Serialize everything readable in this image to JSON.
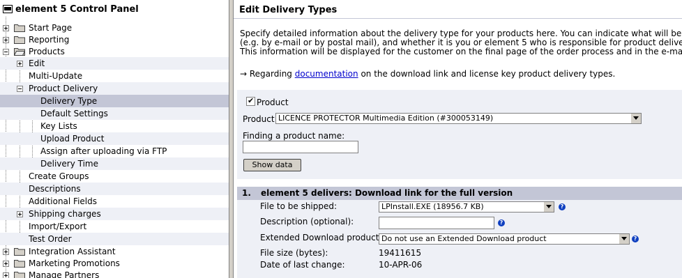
{
  "left_panel": {
    "title": "element 5 Control Panel",
    "items": [
      {
        "label": "Start Page"
      },
      {
        "label": "Reporting"
      },
      {
        "label": "Products"
      },
      {
        "label": "Edit"
      },
      {
        "label": "Multi-Update"
      },
      {
        "label": "Product Delivery"
      },
      {
        "label": "Delivery Type"
      },
      {
        "label": "Default Settings"
      },
      {
        "label": "Key Lists"
      },
      {
        "label": "Upload Product"
      },
      {
        "label": "Assign after uploading via FTP"
      },
      {
        "label": "Delivery Time"
      },
      {
        "label": "Create Groups"
      },
      {
        "label": "Descriptions"
      },
      {
        "label": "Additional Fields"
      },
      {
        "label": "Shipping charges"
      },
      {
        "label": "Import/Export"
      },
      {
        "label": "Test Order"
      },
      {
        "label": "Integration Assistant"
      },
      {
        "label": "Marketing Promotions"
      },
      {
        "label": "Manage Partners"
      }
    ]
  },
  "main": {
    "title": "Edit Delivery Types",
    "intro_line1": "Specify detailed information about the delivery type for your products here. You can indicate what will be deliv",
    "intro_line2": "(e.g. by e-mail or by postal mail), and whether it is you or element 5 who is responsible for product delivery.",
    "intro_line3": "This information will be displayed for the customer on the final page of the order process and in the e-mail wit",
    "regarding_prefix": "→ Regarding ",
    "regarding_link": "documentation",
    "regarding_suffix": " on the download link and license key product delivery types.",
    "product_checkbox_label": "Product",
    "product_label": "Product",
    "product_selected": "LICENCE PROTECTOR Multimedia Edition (#300053149)",
    "finding_label": "Finding a product name:",
    "finding_value": "",
    "show_data_button": "Show data",
    "section_number": "1.",
    "section_title": "element 5 delivers: Download link for the full version",
    "file_label": "File to be shipped:",
    "file_selected": "LPInstall.EXE (18956.7 KB)",
    "description_label": "Description (optional):",
    "description_value": "",
    "extended_label": "Extended Download product:",
    "extended_selected": "Do not use an Extended Download product",
    "filesize_label": "File size (bytes):",
    "filesize_value": "19411615",
    "date_label": "Date of last change:",
    "date_value": "10-APR-06",
    "help_glyph": "?"
  },
  "colors": {
    "selected_row": "#c3c6d6",
    "band": "#eef0f6",
    "link": "#0000cc",
    "help_icon": "#1040c0"
  }
}
